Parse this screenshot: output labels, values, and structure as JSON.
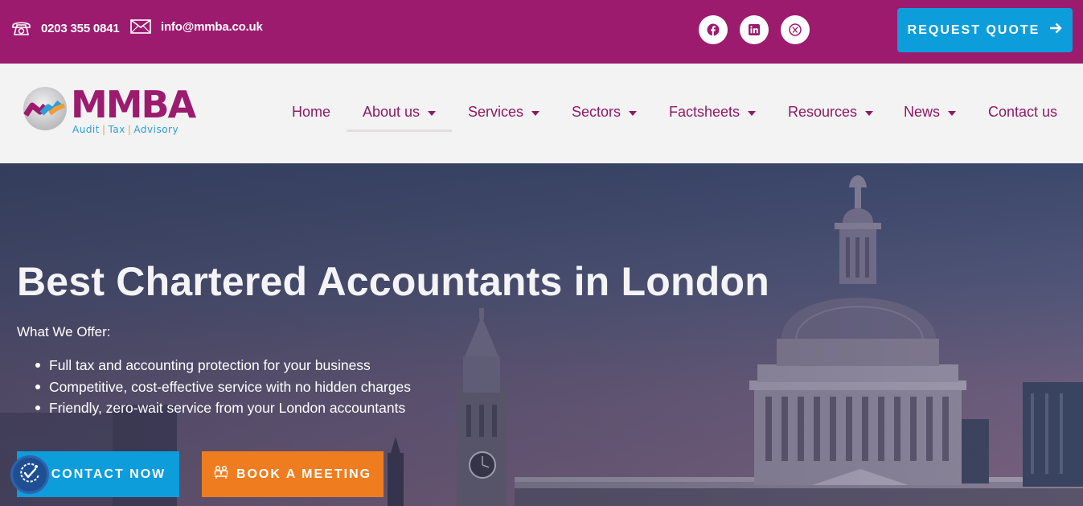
{
  "topbar": {
    "phone": "0203 355 0841",
    "email": "info@mmba.co.uk",
    "social": [
      {
        "name": "facebook-icon"
      },
      {
        "name": "linkedin-icon"
      },
      {
        "name": "x-twitter-icon"
      }
    ],
    "quote_label": "REQUEST QUOTE",
    "background": "#9c1b6f",
    "accent": "#0d9ddb"
  },
  "logo": {
    "name": "MMBA",
    "tagline_1": "Audit",
    "tagline_2": "Tax",
    "tagline_3": "Advisory"
  },
  "nav": {
    "items": [
      {
        "label": "Home",
        "dropdown": false
      },
      {
        "label": "About us",
        "dropdown": true,
        "active": true
      },
      {
        "label": "Services",
        "dropdown": true
      },
      {
        "label": "Sectors",
        "dropdown": true
      },
      {
        "label": "Factsheets",
        "dropdown": true
      },
      {
        "label": "Resources",
        "dropdown": true
      },
      {
        "label": "News",
        "dropdown": true
      },
      {
        "label": "Contact us",
        "dropdown": false
      }
    ]
  },
  "hero": {
    "title": "Best Chartered Accountants in London",
    "offer_heading": "What We Offer:",
    "offers": [
      "Full tax and accounting protection for your business",
      "Competitive, cost-effective service with no hidden charges",
      "Friendly, zero-wait service from your London accountants"
    ],
    "contact_label": "CONTACT NOW",
    "meeting_label": "BOOK A MEETING",
    "meeting_color": "#ef7d1f"
  }
}
